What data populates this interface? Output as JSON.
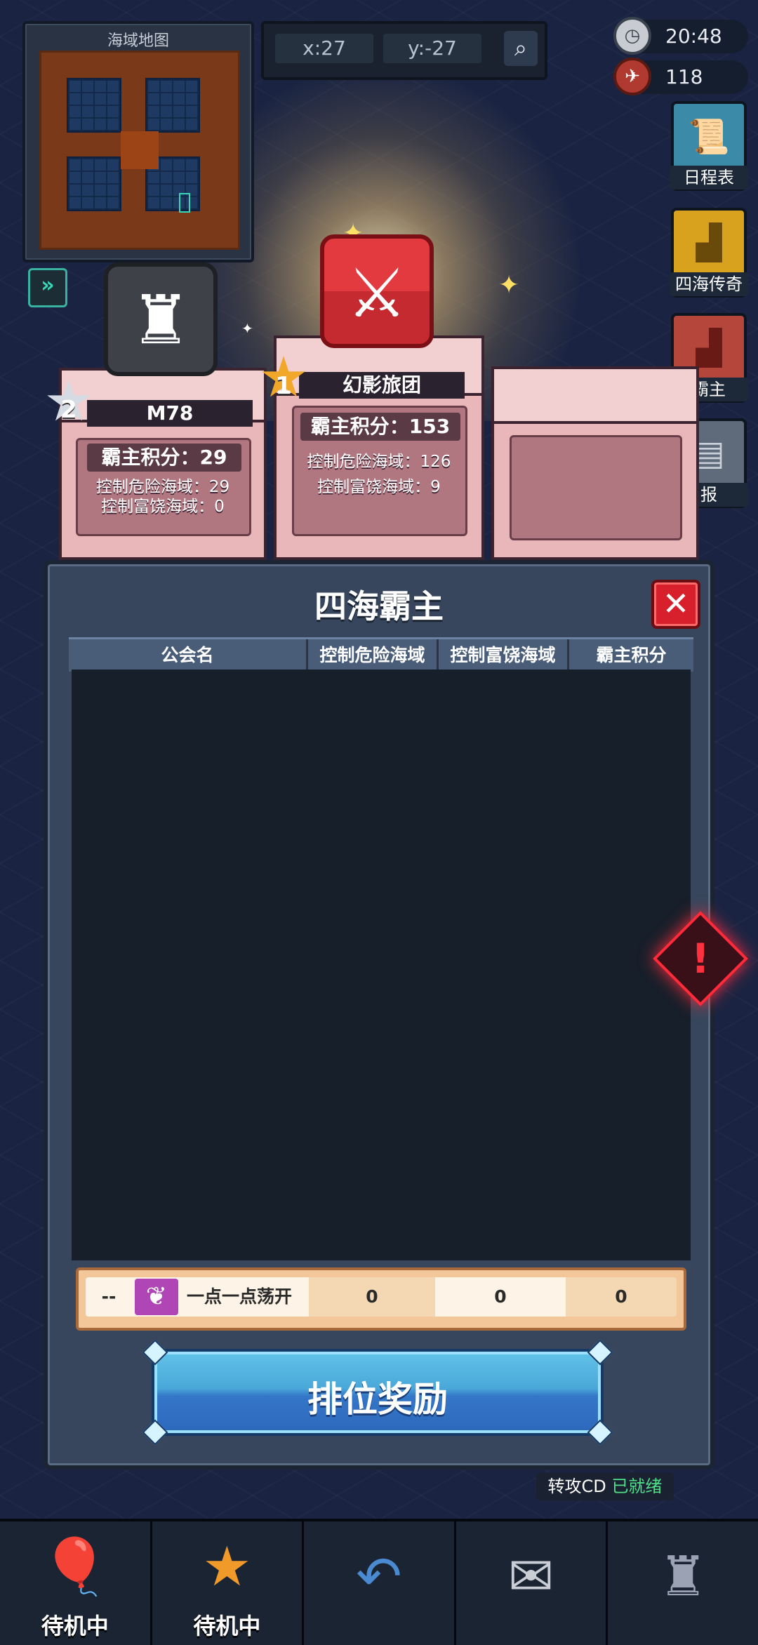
{
  "minimap": {
    "title": "海域地图"
  },
  "coords": {
    "x": "x:27",
    "y": "y:-27"
  },
  "status": {
    "time": "20:48",
    "count": "118"
  },
  "side_menu": [
    {
      "label": "日程表",
      "icon": "scroll-icon",
      "color": "#3b8aa8"
    },
    {
      "label": "四海传奇",
      "icon": "podium-icon",
      "color": "#d8a21e"
    },
    {
      "label": "霸主",
      "icon": "podium-icon",
      "color": "#b4463c"
    },
    {
      "label": "报",
      "icon": "report-icon",
      "color": "#5f6b7a"
    }
  ],
  "podium": {
    "first": {
      "rank": "1",
      "name": "幻影旅团",
      "score": "霸主积分：153",
      "danger": "控制危险海域：126",
      "rich": "控制富饶海域：9"
    },
    "second": {
      "rank": "2",
      "name": "M78",
      "score": "霸主积分：29",
      "danger": "控制危险海域：29",
      "rich": "控制富饶海域：0"
    }
  },
  "dialog": {
    "title": "四海霸主",
    "columns": [
      "公会名",
      "控制危险海域",
      "控制富饶海域",
      "霸主积分"
    ],
    "my_row": {
      "rank": "--",
      "guild": "一点一点荡开",
      "danger": "0",
      "rich": "0",
      "score": "0"
    },
    "reward_button": "排位奖励"
  },
  "cooldown": {
    "label": "转攻CD",
    "status": "已就绪"
  },
  "tabs": [
    {
      "label": "待机中",
      "icon": "balloon-icon"
    },
    {
      "label": "待机中",
      "icon": "star-hero-icon"
    },
    {
      "label": "",
      "icon": "back-arrow-icon"
    },
    {
      "label": "",
      "icon": "mail-icon"
    },
    {
      "label": "",
      "icon": "tower-icon"
    }
  ],
  "colors": {
    "accent_red": "#d8202c",
    "accent_blue": "#3476c8",
    "podium_pink": "#e9b7b9"
  }
}
